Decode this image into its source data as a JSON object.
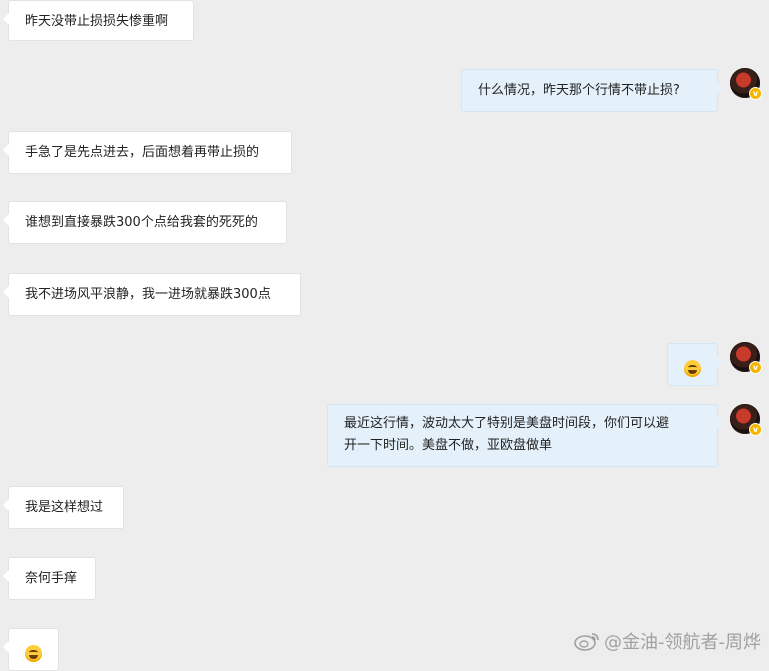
{
  "messages": [
    {
      "side": "left",
      "text": "昨天没带止损损失惨重啊"
    },
    {
      "side": "right",
      "text": "什么情况，昨天那个行情不带止损?"
    },
    {
      "side": "left",
      "text": "手急了是先点进去，后面想着再带止损的"
    },
    {
      "side": "left",
      "text": "谁想到直接暴跌300个点给我套的死死的"
    },
    {
      "side": "left",
      "text": "我不进场风平浪静，我一进场就暴跌300点"
    },
    {
      "side": "right",
      "emoji": "laugh-cry-emoji"
    },
    {
      "side": "right",
      "text_line1": "最近这行情，波动太大了特别是美盘时间段，你们可以避",
      "text_line2": "开一下时间。美盘不做，亚欧盘做单"
    },
    {
      "side": "left",
      "text": "我是这样想过"
    },
    {
      "side": "left",
      "text": "奈何手痒"
    },
    {
      "side": "left",
      "emoji": "laugh-cry-emoji"
    }
  ],
  "watermark": {
    "text": "@金油-领航者-周烨",
    "icon": "weibo-icon"
  },
  "colors": {
    "background": "#ededed",
    "left_bubble": "#ffffff",
    "right_bubble": "#e4f1fb",
    "badge": "#f4b400"
  }
}
